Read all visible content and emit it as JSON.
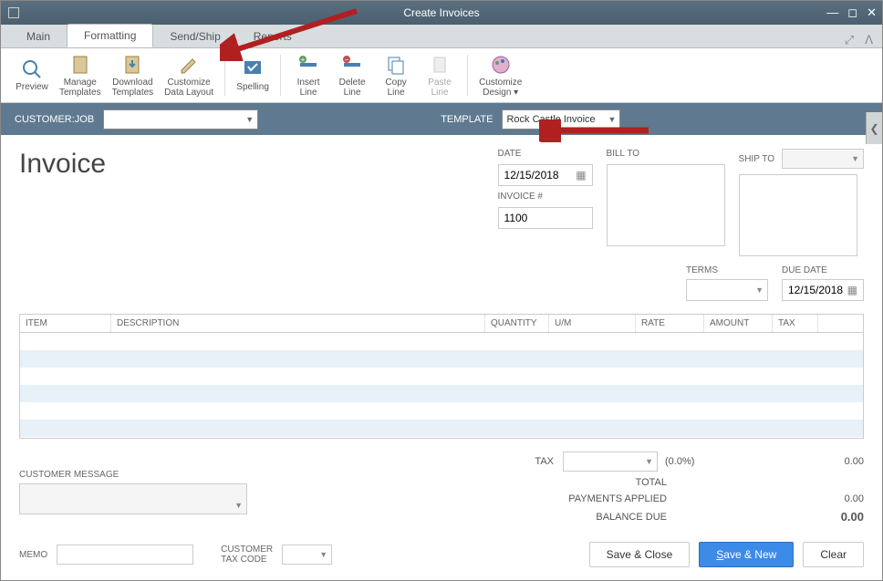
{
  "window": {
    "title": "Create Invoices"
  },
  "tabs": {
    "main": "Main",
    "formatting": "Formatting",
    "sendship": "Send/Ship",
    "reports": "Reports"
  },
  "ribbon": {
    "preview": "Preview",
    "manage_templates": "Manage\nTemplates",
    "download_templates": "Download\nTemplates",
    "customize_data_layout": "Customize\nData Layout",
    "spelling": "Spelling",
    "insert_line": "Insert\nLine",
    "delete_line": "Delete\nLine",
    "copy_line": "Copy\nLine",
    "paste_line": "Paste\nLine",
    "customize_design": "Customize\nDesign ▾"
  },
  "bar": {
    "customer_job_label": "CUSTOMER:JOB",
    "template_label": "TEMPLATE",
    "template_value": "Rock Castle Invoice"
  },
  "invoice": {
    "title": "Invoice",
    "date_label": "DATE",
    "date_value": "12/15/2018",
    "invoice_no_label": "INVOICE #",
    "invoice_no_value": "1100",
    "bill_to_label": "BILL TO",
    "ship_to_label": "SHIP TO",
    "terms_label": "TERMS",
    "due_date_label": "DUE DATE",
    "due_date_value": "12/15/2018"
  },
  "grid": {
    "headers": {
      "item": "ITEM",
      "description": "DESCRIPTION",
      "quantity": "QUANTITY",
      "um": "U/M",
      "rate": "RATE",
      "amount": "AMOUNT",
      "tax": "TAX"
    }
  },
  "totals": {
    "tax_label": "TAX",
    "tax_pct": "(0.0%)",
    "tax_amt": "0.00",
    "total_label": "TOTAL",
    "payments_applied_label": "PAYMENTS APPLIED",
    "payments_applied_amt": "0.00",
    "balance_due_label": "BALANCE DUE",
    "balance_due_amt": "0.00"
  },
  "footer": {
    "customer_message_label": "CUSTOMER MESSAGE",
    "memo_label": "MEMO",
    "customer_tax_code_label": "CUSTOMER\nTAX CODE",
    "save_close": "Save & Close",
    "save_new": "Save & New",
    "clear": "Clear"
  }
}
